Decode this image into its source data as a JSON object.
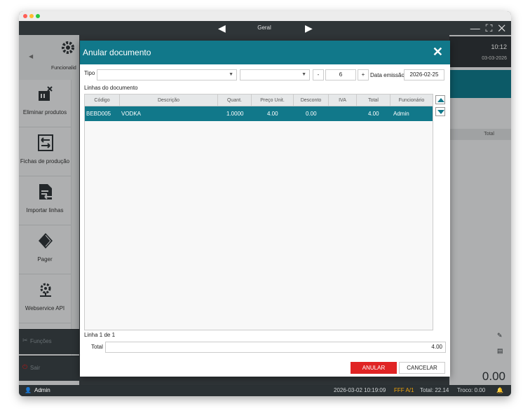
{
  "app": {
    "title": "Geral",
    "nav_prev": "◀",
    "nav_next": "▶",
    "window_controls": "— ⛶ ✕",
    "clock_time": "10:12",
    "clock_date": "03-03-2026"
  },
  "sidebar": {
    "top_label": "Funcionalid",
    "items": [
      {
        "label": "Eliminar produtos",
        "icon": "delete-product-icon"
      },
      {
        "label": "Fichas de produção",
        "icon": "transfer-icon"
      },
      {
        "label": "Importar linhas",
        "icon": "import-lines-icon"
      },
      {
        "label": "Pager",
        "icon": "pager-icon"
      },
      {
        "label": "Webservice API",
        "icon": "webservice-icon"
      }
    ],
    "functions_label": "Funções",
    "exit_label": "Sair"
  },
  "right_panel": {
    "total_header": "Total",
    "amount": "0.00"
  },
  "status_bar": {
    "user": "Admin",
    "datetime": "2026-03-02 10:19:09",
    "doc": "FFF A/1",
    "total": "Total: 22.14",
    "change": "Troco: 0.00"
  },
  "modal": {
    "title": "Anular documento",
    "close": "✕",
    "tipo_label": "Tipo",
    "tipo_value": "",
    "serie_value": "",
    "minus": "-",
    "number": "6",
    "plus": "+",
    "date_label": "Data emissão",
    "date_value": "2026-02-25",
    "lines_label": "Linhas do documento",
    "columns": [
      "Código",
      "Descrição",
      "Quant.",
      "Preço Unit.",
      "Desconto",
      "IVA",
      "Total",
      "Funcionário"
    ],
    "rows": [
      {
        "codigo": "BEBD005",
        "descricao": "VODKA",
        "quant": "1.0000",
        "preco": "4.00",
        "desconto": "0.00",
        "iva": "",
        "total": "4.00",
        "funcionario": "Admin"
      }
    ],
    "line_count": "Linha 1 de 1",
    "total_label": "Total",
    "total_value": "4.00",
    "anular_label": "ANULAR",
    "cancelar_label": "CANCELAR"
  },
  "colors": {
    "accent": "#11788a",
    "danger": "#e02424",
    "warning": "#f0a30a"
  }
}
